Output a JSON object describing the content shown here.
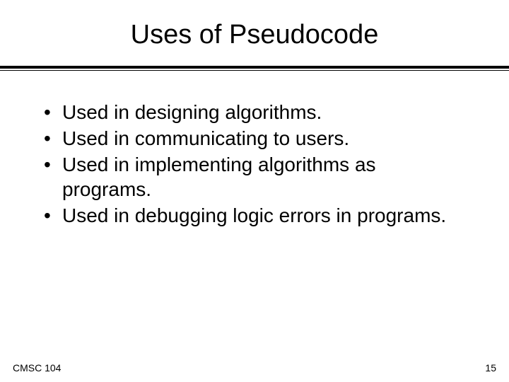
{
  "title": "Uses of Pseudocode",
  "bullets": [
    "Used in designing algorithms.",
    "Used in communicating to users.",
    "Used in implementing algorithms as programs.",
    "Used in debugging logic errors in programs."
  ],
  "footer": {
    "left": "CMSC 104",
    "right": "15"
  }
}
